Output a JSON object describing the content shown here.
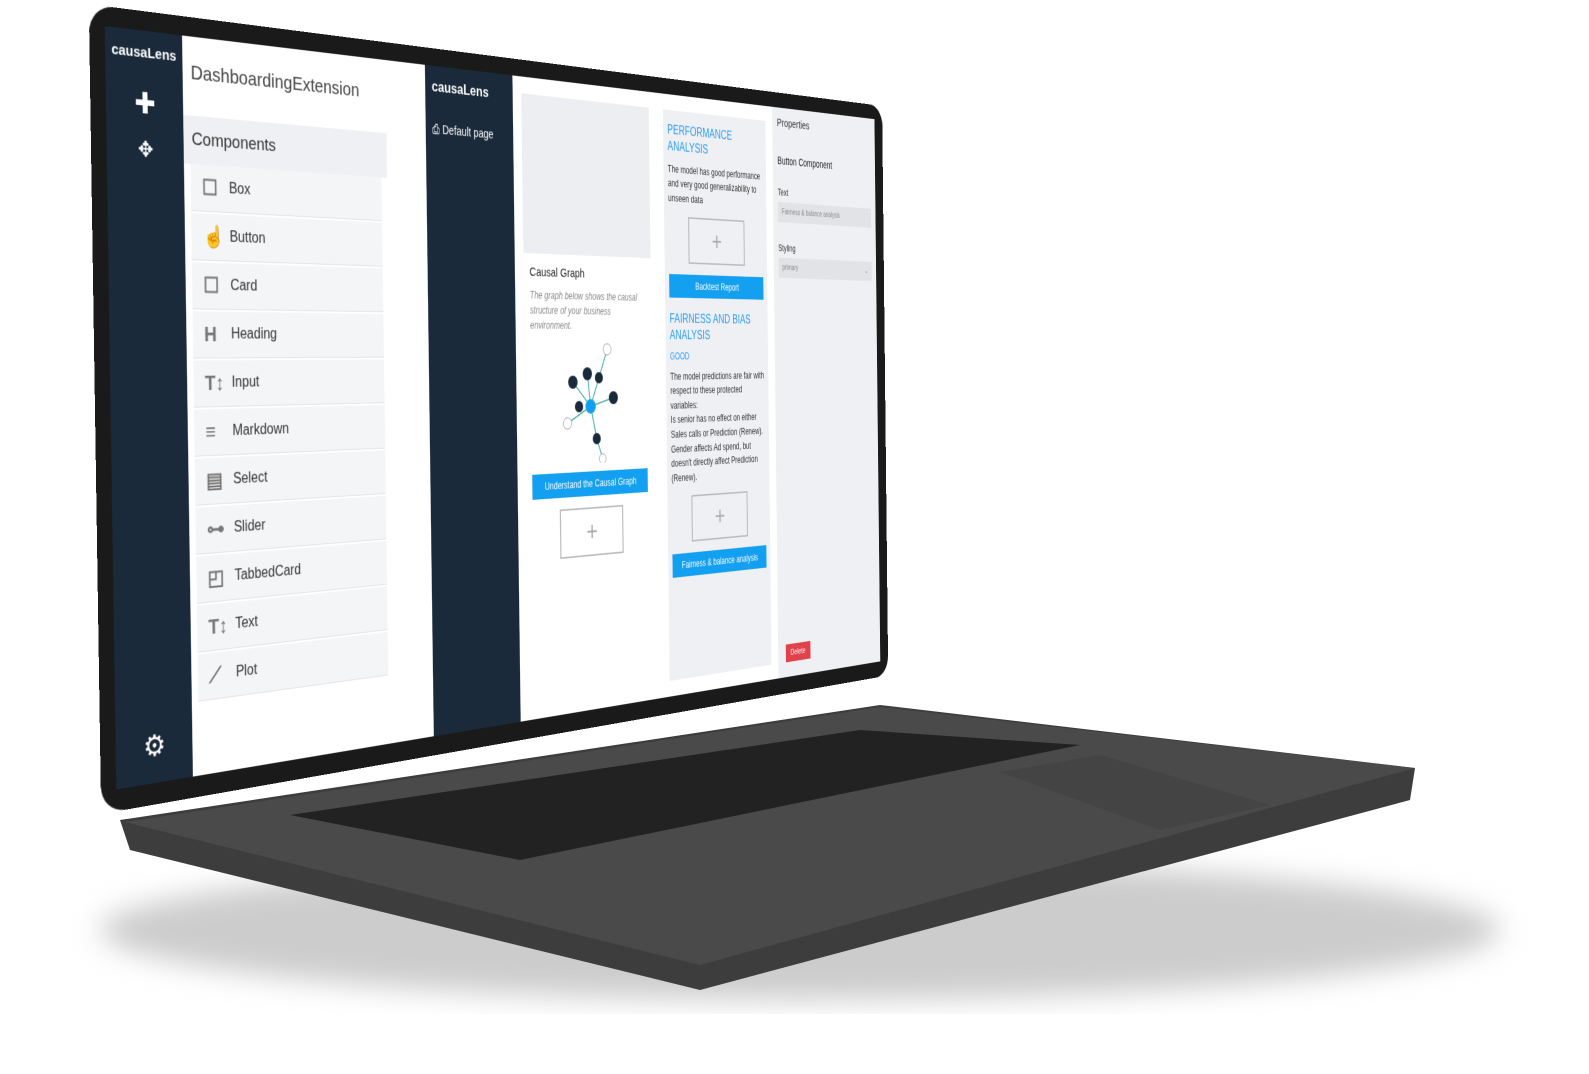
{
  "brand": {
    "logo": "causaLens"
  },
  "app_title": "DashboardingExtension",
  "components": {
    "title": "Components",
    "items": [
      {
        "label": "Box",
        "icon": "square-icon"
      },
      {
        "label": "Button",
        "icon": "pointer-hand-icon"
      },
      {
        "label": "Card",
        "icon": "square-icon"
      },
      {
        "label": "Heading",
        "icon": "heading-icon"
      },
      {
        "label": "Input",
        "icon": "text-input-icon"
      },
      {
        "label": "Markdown",
        "icon": "lines-icon"
      },
      {
        "label": "Select",
        "icon": "select-icon"
      },
      {
        "label": "Slider",
        "icon": "slider-icon"
      },
      {
        "label": "TabbedCard",
        "icon": "tabbed-card-icon"
      },
      {
        "label": "Text",
        "icon": "text-icon"
      },
      {
        "label": "Plot",
        "icon": "chart-icon"
      }
    ]
  },
  "preview": {
    "logo": "causaLens",
    "page": "Default page",
    "causal": {
      "title": "Causal Graph",
      "desc": "The graph below shows the causal structure of your business environment.",
      "button": "Understand the Causal Graph"
    },
    "performance": {
      "title": "PERFORMANCE ANALYSIS",
      "text": "The model has good performance and very good generalizability to unseen data",
      "button": "Backtest Report"
    },
    "fairness": {
      "title": "FAIRNESS AND BIAS ANALYSIS",
      "status": "GOOD",
      "text": "The model predictions are fair with respect to these protected variables:",
      "line1": "Is senior has no effect on either Sales calls or Prediction (Renew).",
      "line2": "Gender affects Ad spend, but doesn't directly affect Prediction (Renew).",
      "button": "Fairness & balance analysis"
    }
  },
  "properties": {
    "title": "Properties",
    "component": "Button Component",
    "text_label": "Text",
    "text_value": "Fairness & balance analysis",
    "styling_label": "Styling",
    "styling_value": "primary",
    "delete": "Delete"
  },
  "colors": {
    "nav": "#1b2a3b",
    "accent": "#14a0f0",
    "danger": "#e0414a"
  }
}
